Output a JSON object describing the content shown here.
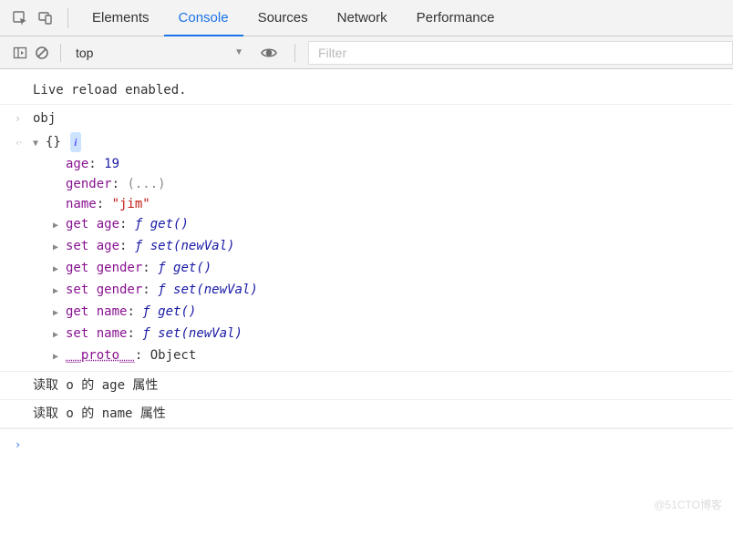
{
  "tabs": {
    "elements": "Elements",
    "console": "Console",
    "sources": "Sources",
    "network": "Network",
    "performance": "Performance"
  },
  "toolbar": {
    "context": "top",
    "filter_placeholder": "Filter"
  },
  "log": {
    "live_reload": "Live reload enabled.",
    "input1": "obj",
    "obj_open": "{}",
    "info_badge": "i",
    "props": {
      "age_key": "age",
      "age_val": "19",
      "gender_key": "gender",
      "gender_val": "(...)",
      "name_key": "name",
      "name_val": "\"jim\""
    },
    "accessors": {
      "get_age_k": "get age",
      "get_age_v": "get()",
      "set_age_k": "set age",
      "set_age_v": "set(newVal)",
      "get_gender_k": "get gender",
      "get_gender_v": "get()",
      "set_gender_k": "set gender",
      "set_gender_v": "set(newVal)",
      "get_name_k": "get name",
      "get_name_v": "get()",
      "set_name_k": "set name",
      "set_name_v": "set(newVal)"
    },
    "proto_key": "__proto__",
    "proto_val": "Object",
    "f_glyph": "ƒ",
    "msg1": "读取 o 的 age 属性",
    "msg2": "读取 o 的 name 属性"
  },
  "watermark": "@51CTO博客"
}
